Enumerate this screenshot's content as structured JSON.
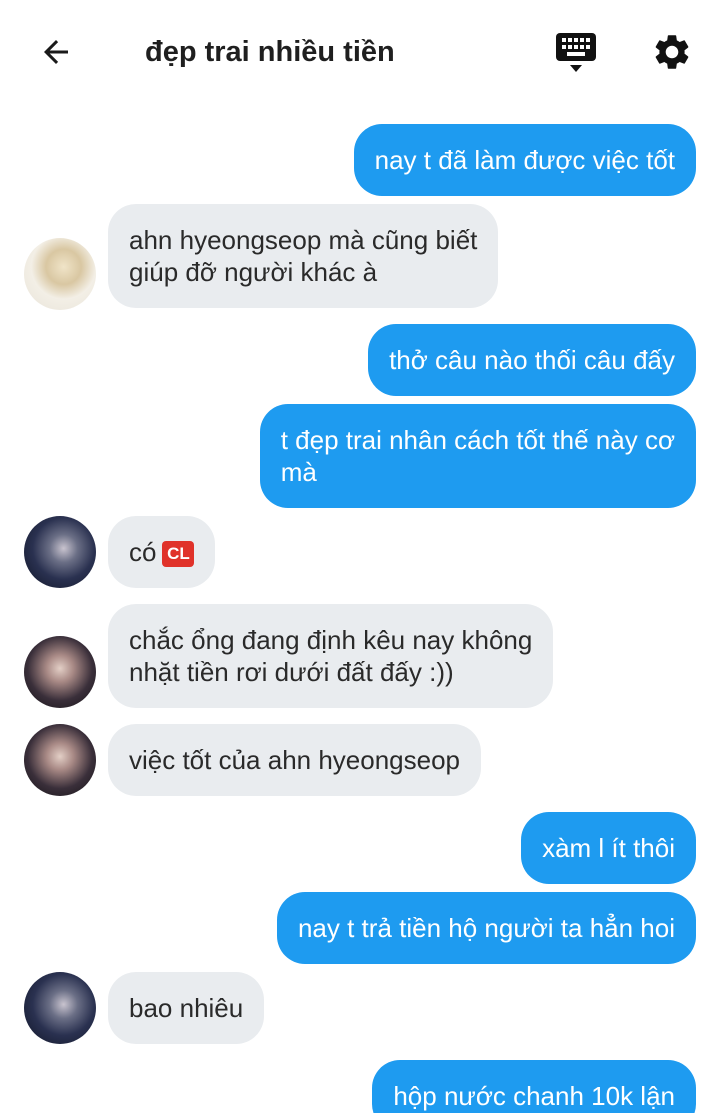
{
  "header": {
    "title": "đẹp trai nhiều tiền",
    "back_icon": "arrow-left-icon",
    "keyboard_icon": "keyboard-icon",
    "settings_icon": "gear-icon"
  },
  "colors": {
    "outgoing_bubble": "#1e9bf0",
    "incoming_bubble": "#e9ecef",
    "header_text": "#1f1f1f"
  },
  "messages": [
    {
      "direction": "out",
      "text": "nay t đã làm được việc tốt"
    },
    {
      "direction": "in",
      "text": "ahn hyeongseop mà cũng biết\ngiúp đỡ người khác à"
    },
    {
      "direction": "out",
      "text": "thở câu nào thối câu đấy"
    },
    {
      "direction": "out",
      "text": "t đẹp trai nhân cách tốt thế này cơ\nmà"
    },
    {
      "direction": "in",
      "text": "có",
      "badge": "CL"
    },
    {
      "direction": "in",
      "text": "chắc ổng đang định kêu nay không\nnhặt tiền rơi dưới đất đấy :))"
    },
    {
      "direction": "in",
      "text": "việc tốt của ahn hyeongseop"
    },
    {
      "direction": "out",
      "text": "xàm l ít thôi"
    },
    {
      "direction": "out",
      "text": "nay t trả tiền hộ người ta hẳn hoi"
    },
    {
      "direction": "in",
      "text": "bao nhiêu"
    },
    {
      "direction": "out",
      "text": "hộp nước chanh 10k lận"
    }
  ]
}
